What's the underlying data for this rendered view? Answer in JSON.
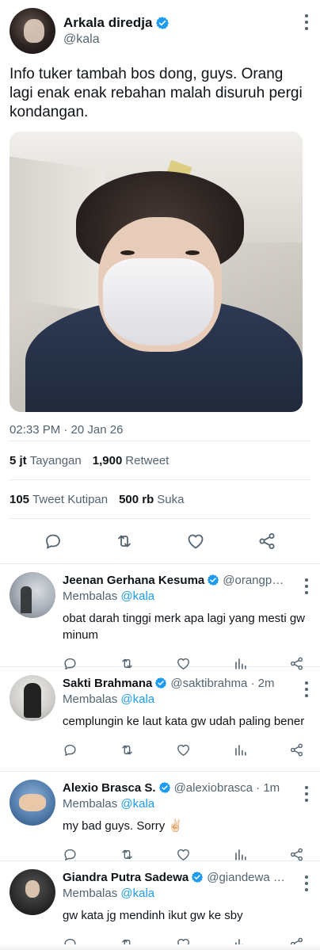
{
  "tweet": {
    "name": "Arkala diredja",
    "handle": "@kala",
    "text": "Info tuker tambah bos dong, guys. Orang lagi enak enak rebahan malah disuruh pergi kondangan.",
    "time": "02:33 PM · 20 Jan 26",
    "views_count": "5 jt",
    "views_label": "Tayangan",
    "retweets_count": "1,900",
    "retweets_label": "Retweet",
    "quotes_count": "105",
    "quotes_label": "Tweet Kutipan",
    "likes_count": "500 rb",
    "likes_label": "Suka"
  },
  "replies": [
    {
      "name": "Jeenan Gerhana Kesuma",
      "handle": "@orangpe...",
      "replying_prefix": "Membalas",
      "replying_to": "@kala",
      "text": "obat darah tinggi merk apa lagi yang mesti gw minum",
      "avatar": "avatar-photo"
    },
    {
      "name": "Sakti Brahmana",
      "handle": "@saktibrahma · 2m",
      "replying_prefix": "Membalas",
      "replying_to": "@kala",
      "text": "cemplungin ke laut kata gw udah paling bener",
      "avatar": "avatar-photo"
    },
    {
      "name": "Alexio Brasca S.",
      "handle": "@alexiobrasca · 1m",
      "replying_prefix": "Membalas",
      "replying_to": "@kala",
      "text": "my bad guys. Sorry ✌🏻",
      "avatar": "avatar-photo"
    },
    {
      "name": "Giandra Putra Sadewa",
      "handle": "@giandewa · ...",
      "replying_prefix": "Membalas",
      "replying_to": "@kala",
      "text": "gw kata jg mendinh ikut gw ke sby",
      "avatar": "avatar-photo"
    }
  ],
  "colors": {
    "accent": "#1d9bf0",
    "muted": "#536471",
    "text": "#0f1419",
    "divider": "#e6ecf0"
  },
  "icons": [
    "verified-badge-icon",
    "more-icon",
    "reply-icon",
    "retweet-icon",
    "like-icon",
    "views-icon",
    "share-icon"
  ]
}
